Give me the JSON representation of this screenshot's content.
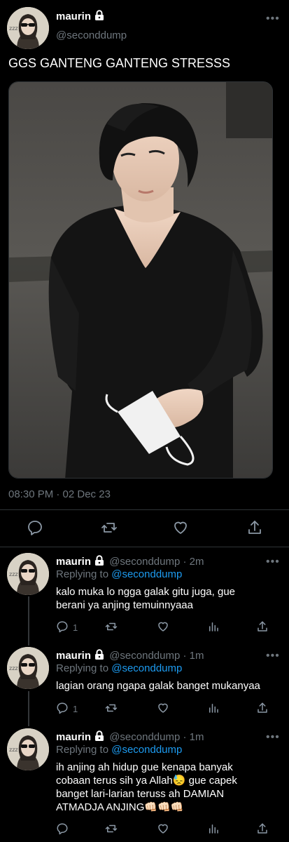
{
  "tweet": {
    "name": "maurin",
    "handle": "@seconddump",
    "text": "GGS GANTENG GANTENG STRESSS",
    "timestamp": "08:30 PM · 02 Dec 23"
  },
  "replies": [
    {
      "name": "maurin",
      "handle": "@seconddump",
      "time": "· 2m",
      "replying_label": "Replying to",
      "replying_to": "@seconddump",
      "text": "kalo muka lo ngga galak gitu juga, gue berani ya anjing temuinnyaaa",
      "reply_count": "1"
    },
    {
      "name": "maurin",
      "handle": "@seconddump",
      "time": "· 1m",
      "replying_label": "Replying to",
      "replying_to": "@seconddump",
      "text": "lagian orang ngapa galak banget mukanyaa",
      "reply_count": "1"
    },
    {
      "name": "maurin",
      "handle": "@seconddump",
      "time": "· 1m",
      "replying_label": "Replying to",
      "replying_to": "@seconddump",
      "text": "ih anjing ah hidup gue kenapa banyak cobaan terus sih ya Allah😓 gue capek banget lari-larian teruss ah DAMIAN ATMADJA ANJING👊🏻👊🏻👊🏻"
    }
  ],
  "icons": [
    "lock-icon",
    "more-icon",
    "reply-icon",
    "retweet-icon",
    "like-icon",
    "share-icon",
    "stats-icon"
  ],
  "colors": {
    "background": "#000000",
    "muted": "#6e767d",
    "link": "#1d9bf0",
    "divider": "#2f3336"
  }
}
